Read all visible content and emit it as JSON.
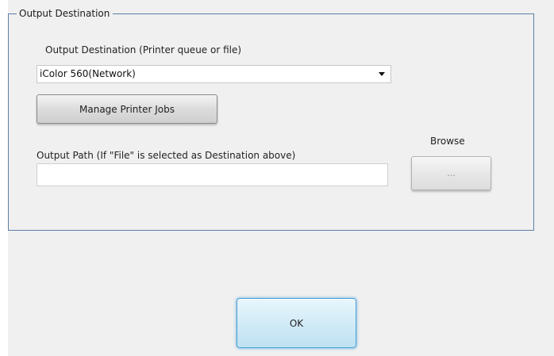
{
  "group": {
    "title": "Output Destination"
  },
  "destination": {
    "label": "Output Destination (Printer queue or file)",
    "selected": "iColor 560(Network)"
  },
  "buttons": {
    "manage_printer_jobs": "Manage Printer Jobs",
    "browse_label": "Browse",
    "browse_button": "...",
    "ok": "OK"
  },
  "output_path": {
    "label": "Output Path (If \"File\" is selected as Destination above)",
    "value": ""
  }
}
